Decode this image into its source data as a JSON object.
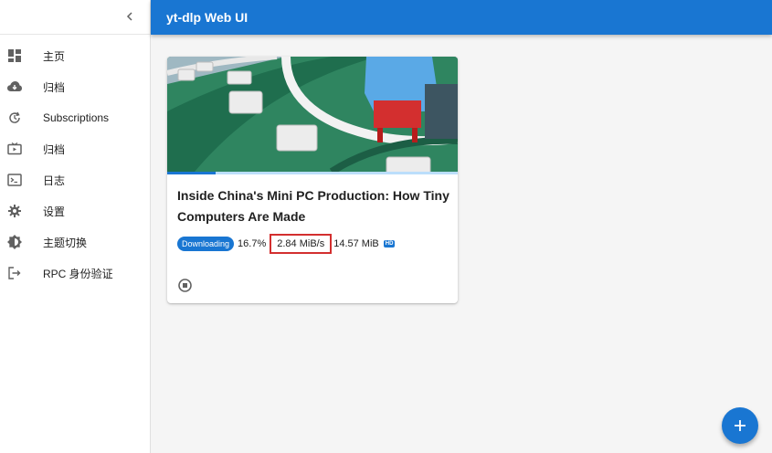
{
  "header": {
    "title": "yt-dlp Web UI"
  },
  "sidebar": {
    "items": [
      {
        "label": "主页",
        "icon": "dashboard-icon"
      },
      {
        "label": "归档",
        "icon": "cloud-download-icon"
      },
      {
        "label": "Subscriptions",
        "icon": "update-icon"
      },
      {
        "label": "归档",
        "icon": "live-tv-icon"
      },
      {
        "label": "日志",
        "icon": "terminal-icon"
      },
      {
        "label": "设置",
        "icon": "gear-icon"
      },
      {
        "label": "主题切换",
        "icon": "brightness-icon"
      },
      {
        "label": "RPC 身份验证",
        "icon": "logout-icon"
      }
    ]
  },
  "download": {
    "title": "Inside China's Mini PC Production: How Tiny Computers Are Made",
    "status": "Downloading",
    "percent": "16.7%",
    "progress": 0.167,
    "speed": "2.84 MiB/s",
    "size": "14.57 MiB",
    "quality_badge": "HD"
  },
  "colors": {
    "primary": "#1976d2",
    "highlight_border": "#d32f2f"
  }
}
